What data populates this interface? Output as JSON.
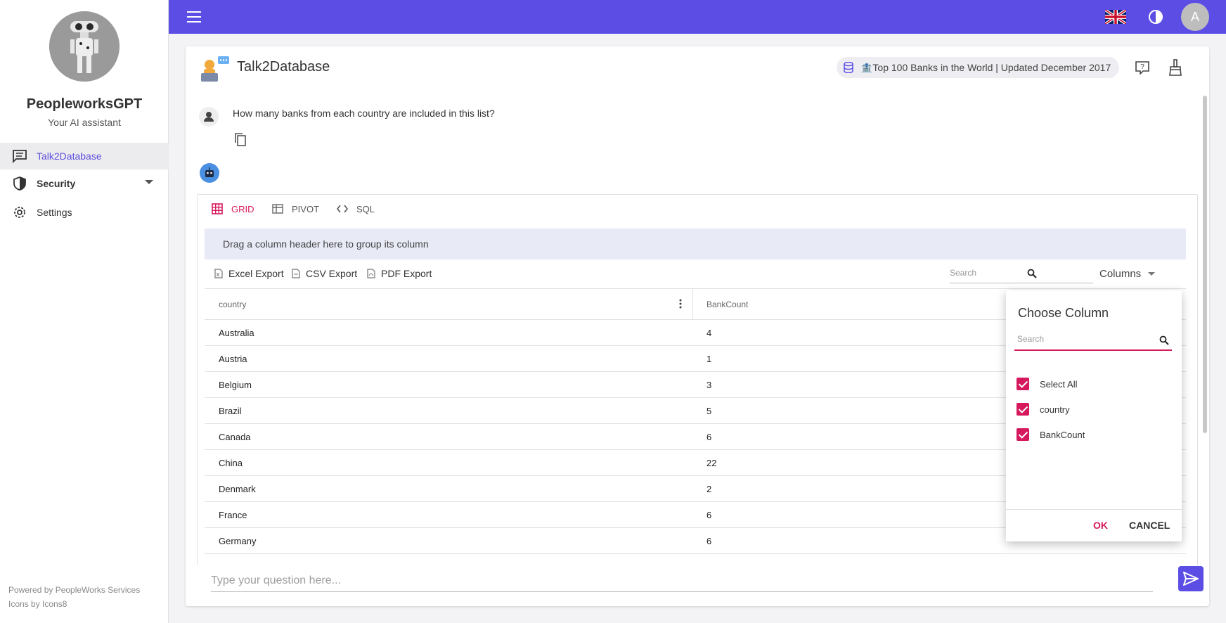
{
  "sidebar": {
    "brand_name": "PeopleworksGPT",
    "brand_sub": "Your AI assistant",
    "items": [
      {
        "label": "Talk2Database",
        "icon": "chat-icon",
        "active": true
      },
      {
        "label": "Security",
        "icon": "shield-icon",
        "expandable": true
      },
      {
        "label": "Settings",
        "icon": "gear-icon"
      }
    ],
    "footer": [
      "Powered by PeopleWorks Services",
      "Icons by Icons8"
    ]
  },
  "topbar": {
    "accent_color": "#5c4ee5",
    "language_icon": "uk-flag-icon",
    "theme_icon": "contrast-icon",
    "avatar_initial": "A"
  },
  "header": {
    "title": "Talk2Database",
    "dataset": "🏦Top 100 Banks in the World | Updated December 2017"
  },
  "conversation": {
    "question": "How many banks from each country are included in this list?"
  },
  "result": {
    "tabs": [
      {
        "label": "GRID",
        "active": true
      },
      {
        "label": "PIVOT"
      },
      {
        "label": "SQL"
      }
    ],
    "group_panel": "Drag a column header here to group its column",
    "toolbar": {
      "excel": "Excel Export",
      "csv": "CSV Export",
      "pdf": "PDF Export",
      "search_placeholder": "Search",
      "columns": "Columns"
    },
    "columns": [
      "country",
      "BankCount"
    ],
    "rows": [
      [
        "Australia",
        "4"
      ],
      [
        "Austria",
        "1"
      ],
      [
        "Belgium",
        "3"
      ],
      [
        "Brazil",
        "5"
      ],
      [
        "Canada",
        "6"
      ],
      [
        "China",
        "22"
      ],
      [
        "Denmark",
        "2"
      ],
      [
        "France",
        "6"
      ],
      [
        "Germany",
        "6"
      ]
    ]
  },
  "column_chooser": {
    "title": "Choose Column",
    "search_placeholder": "Search",
    "options": [
      "Select All",
      "country",
      "BankCount"
    ],
    "ok": "OK",
    "cancel": "CANCEL",
    "accent_color": "#d6185c"
  },
  "input": {
    "placeholder": "Type your question here..."
  }
}
